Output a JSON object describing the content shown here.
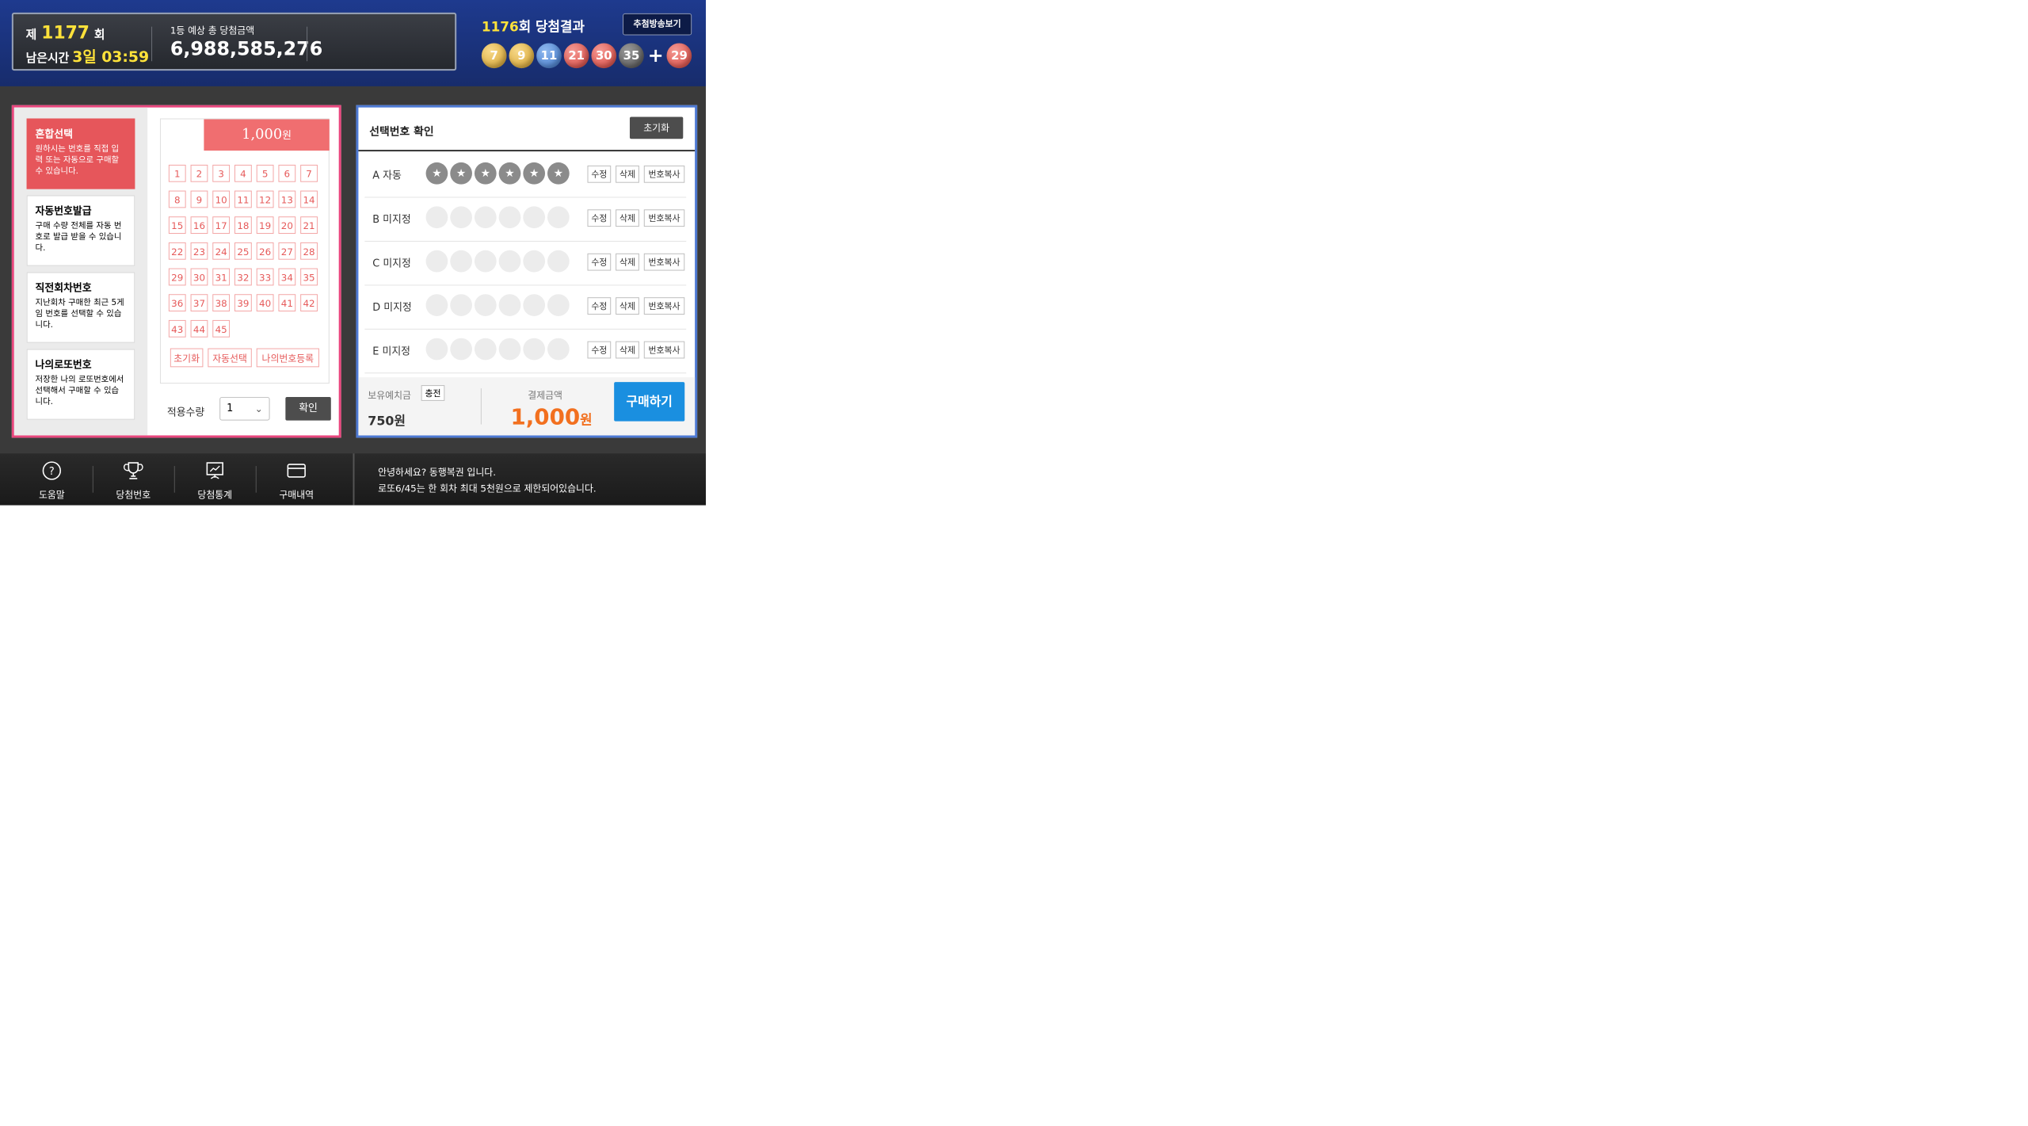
{
  "header": {
    "round_prefix": "제",
    "round_number": "1177",
    "round_suffix": "회",
    "remain_label": "남은시간",
    "remain_time": "3일 03:59",
    "prize_label": "1등 예상 총 당첨금액",
    "prize_value": "6,988,585,276",
    "result_round": "1176",
    "result_title": "회 당첨결과",
    "draw_video_label": "추첨방송보기",
    "winning_numbers": [
      "7",
      "9",
      "11",
      "21",
      "30",
      "35"
    ],
    "bonus_number": "29",
    "plus": "+"
  },
  "modes": [
    {
      "title": "혼합선택",
      "desc": "원하시는 번호를 직접 입력 또는 자동으로 구매할 수 있습니다."
    },
    {
      "title": "자동번호발급",
      "desc": "구매 수량 전체를 자동 번호로 발급 받을 수 있습니다."
    },
    {
      "title": "직전회차번호",
      "desc": "지난회차 구매한 최근 5게임 번호를 선택할 수 있습니다."
    },
    {
      "title": "나의로또번호",
      "desc": "저장한 나의 로또번호에서 선택해서 구매할 수 있습니다."
    }
  ],
  "picker": {
    "price": "1,000",
    "price_unit": "원",
    "numbers": [
      "1",
      "2",
      "3",
      "4",
      "5",
      "6",
      "7",
      "8",
      "9",
      "10",
      "11",
      "12",
      "13",
      "14",
      "15",
      "16",
      "17",
      "18",
      "19",
      "20",
      "21",
      "22",
      "23",
      "24",
      "25",
      "26",
      "27",
      "28",
      "29",
      "30",
      "31",
      "32",
      "33",
      "34",
      "35",
      "36",
      "37",
      "38",
      "39",
      "40",
      "41",
      "42",
      "43",
      "44",
      "45"
    ],
    "reset_label": "초기화",
    "auto_label": "자동선택",
    "mynum_label": "나의번호등록",
    "qty_label": "적용수량",
    "qty_value": "1",
    "confirm_label": "확인"
  },
  "selection": {
    "title": "선택번호 확인",
    "reset_label": "초기화",
    "rows": [
      {
        "label": "A 자동",
        "auto": true
      },
      {
        "label": "B 미지정",
        "auto": false
      },
      {
        "label": "C 미지정",
        "auto": false
      },
      {
        "label": "D 미지정",
        "auto": false
      },
      {
        "label": "E 미지정",
        "auto": false
      }
    ],
    "edit_label": "수정",
    "delete_label": "삭제",
    "copy_label": "번호복사",
    "balance_label": "보유예치금",
    "charge_label": "충전",
    "balance_value": "750원",
    "pay_label": "결제금액",
    "pay_value": "1,000",
    "pay_unit": "원",
    "buy_label": "구매하기"
  },
  "footer": {
    "nav": [
      {
        "label": "도움말",
        "icon": "help-icon"
      },
      {
        "label": "당첨번호",
        "icon": "trophy-icon"
      },
      {
        "label": "당첨통계",
        "icon": "chart-board-icon"
      },
      {
        "label": "구매내역",
        "icon": "card-icon"
      }
    ],
    "message_line1": "안녕하세요? 동행복권 입니다.",
    "message_line2": "로또6/45는 한 회차 최대 5천원으로 제한되어있습니다."
  },
  "colors": {
    "header_bg": "#1e3a8e",
    "left_border": "#e8467d",
    "right_border": "#4d79d3",
    "active_mode": "#e6565b",
    "buy_button": "#1a8fe0",
    "pay_amount": "#f2701f",
    "highlight_yellow": "#ffe23a"
  }
}
